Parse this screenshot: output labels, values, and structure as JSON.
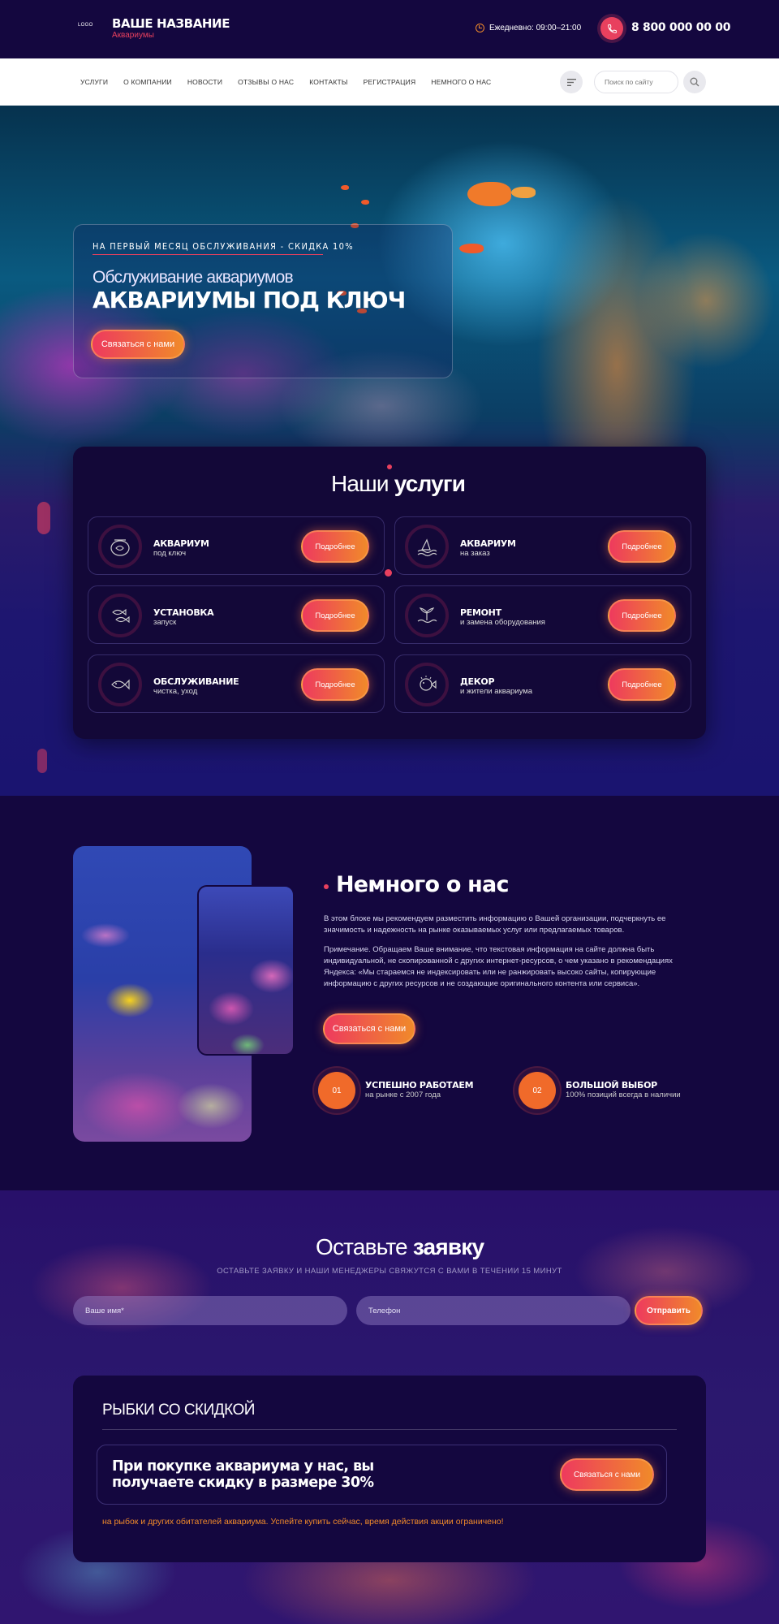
{
  "header": {
    "logo": "LOGO",
    "title": "ВАШЕ НАЗВАНИЕ",
    "subtitle": "Аквариумы",
    "hours": "Ежедневно: 09:00–21:00",
    "phone": "8 800 000 00 00",
    "icons": {
      "clock": "clock-icon",
      "phone": "phone-icon"
    },
    "accent": "#e8405e"
  },
  "nav": {
    "items": [
      "Услуги",
      "О компании",
      "Новости",
      "Отзывы о нас",
      "Контакты",
      "Регистрация",
      "Немного о нас"
    ],
    "search_placeholder": "Поиск по сайту"
  },
  "hero": {
    "promo": "НА ПЕРВЫЙ МЕСЯЦ ОБСЛУЖИВАНИЯ - СКИДКА 10%",
    "subtitle": "Обслуживание аквариумов",
    "title": "АКВАРИУМЫ ПОД КЛЮЧ",
    "button": "Связаться с нами"
  },
  "services": {
    "title_light": "Наши",
    "title_bold": "услуги",
    "items": [
      {
        "name": "АКВАРИУМ",
        "desc": "под ключ",
        "icon": "fishbowl-icon",
        "button": "Подробнее"
      },
      {
        "name": "АКВАРИУМ",
        "desc": "на заказ",
        "icon": "shark-icon",
        "button": "Подробнее"
      },
      {
        "name": "УСТАНОВКА",
        "desc": "запуск",
        "icon": "fishes-icon",
        "button": "Подробнее"
      },
      {
        "name": "РЕМОНТ",
        "desc": "и замена оборудования",
        "icon": "whale-tail-icon",
        "button": "Подробнее"
      },
      {
        "name": "ОБСЛУЖИВАНИЕ",
        "desc": "чистка, уход",
        "icon": "fish-icon",
        "button": "Подробнее"
      },
      {
        "name": "ДЕКОР",
        "desc": "и жители аквариума",
        "icon": "puffer-fish-icon",
        "button": "Подробнее"
      }
    ]
  },
  "about": {
    "title": "Немного о нас",
    "p1": "В этом блоке мы рекомендуем разместить информацию о Вашей организации, подчеркнуть ее значимость и надежность на рынке оказываемых услуг или предлагаемых товаров.",
    "p2": "Примечание. Обращаем Ваше внимание, что текстовая информация на сайте должна быть индивидуальной, не скопированной с других интернет-ресурсов, о чем указано в рекомендациях Яндекса: «Мы стараемся не индексировать или не ранжировать высоко сайты, копирующие информацию с других ресурсов и не создающие оригинального контента или сервиса».",
    "button": "Связаться с нами",
    "stats": [
      {
        "num": "01",
        "name": "УСПЕШНО РАБОТАЕМ",
        "desc": "на рынке с 2007 года"
      },
      {
        "num": "02",
        "name": "БОЛЬШОЙ ВЫБОР",
        "desc": "100% позиций всегда в наличии"
      }
    ]
  },
  "apply": {
    "title_light": "Оставьте",
    "title_bold": "заявку",
    "subtitle": "Оставьте заявку и наши менеджеры свяжутся с вами в течении 15 минут",
    "name_placeholder": "Ваше имя*",
    "phone_placeholder": "Телефон",
    "button": "Отправить"
  },
  "discount": {
    "title": "РЫБКИ СО СКИДКОЙ",
    "text": "При покупке аквариума у нас, вы получаете скидку в размере 30%",
    "button": "Связаться с нами",
    "note": "на рыбок и других обитателей аквариума. Успейте купить сейчас, время действия акции ограничено!"
  }
}
